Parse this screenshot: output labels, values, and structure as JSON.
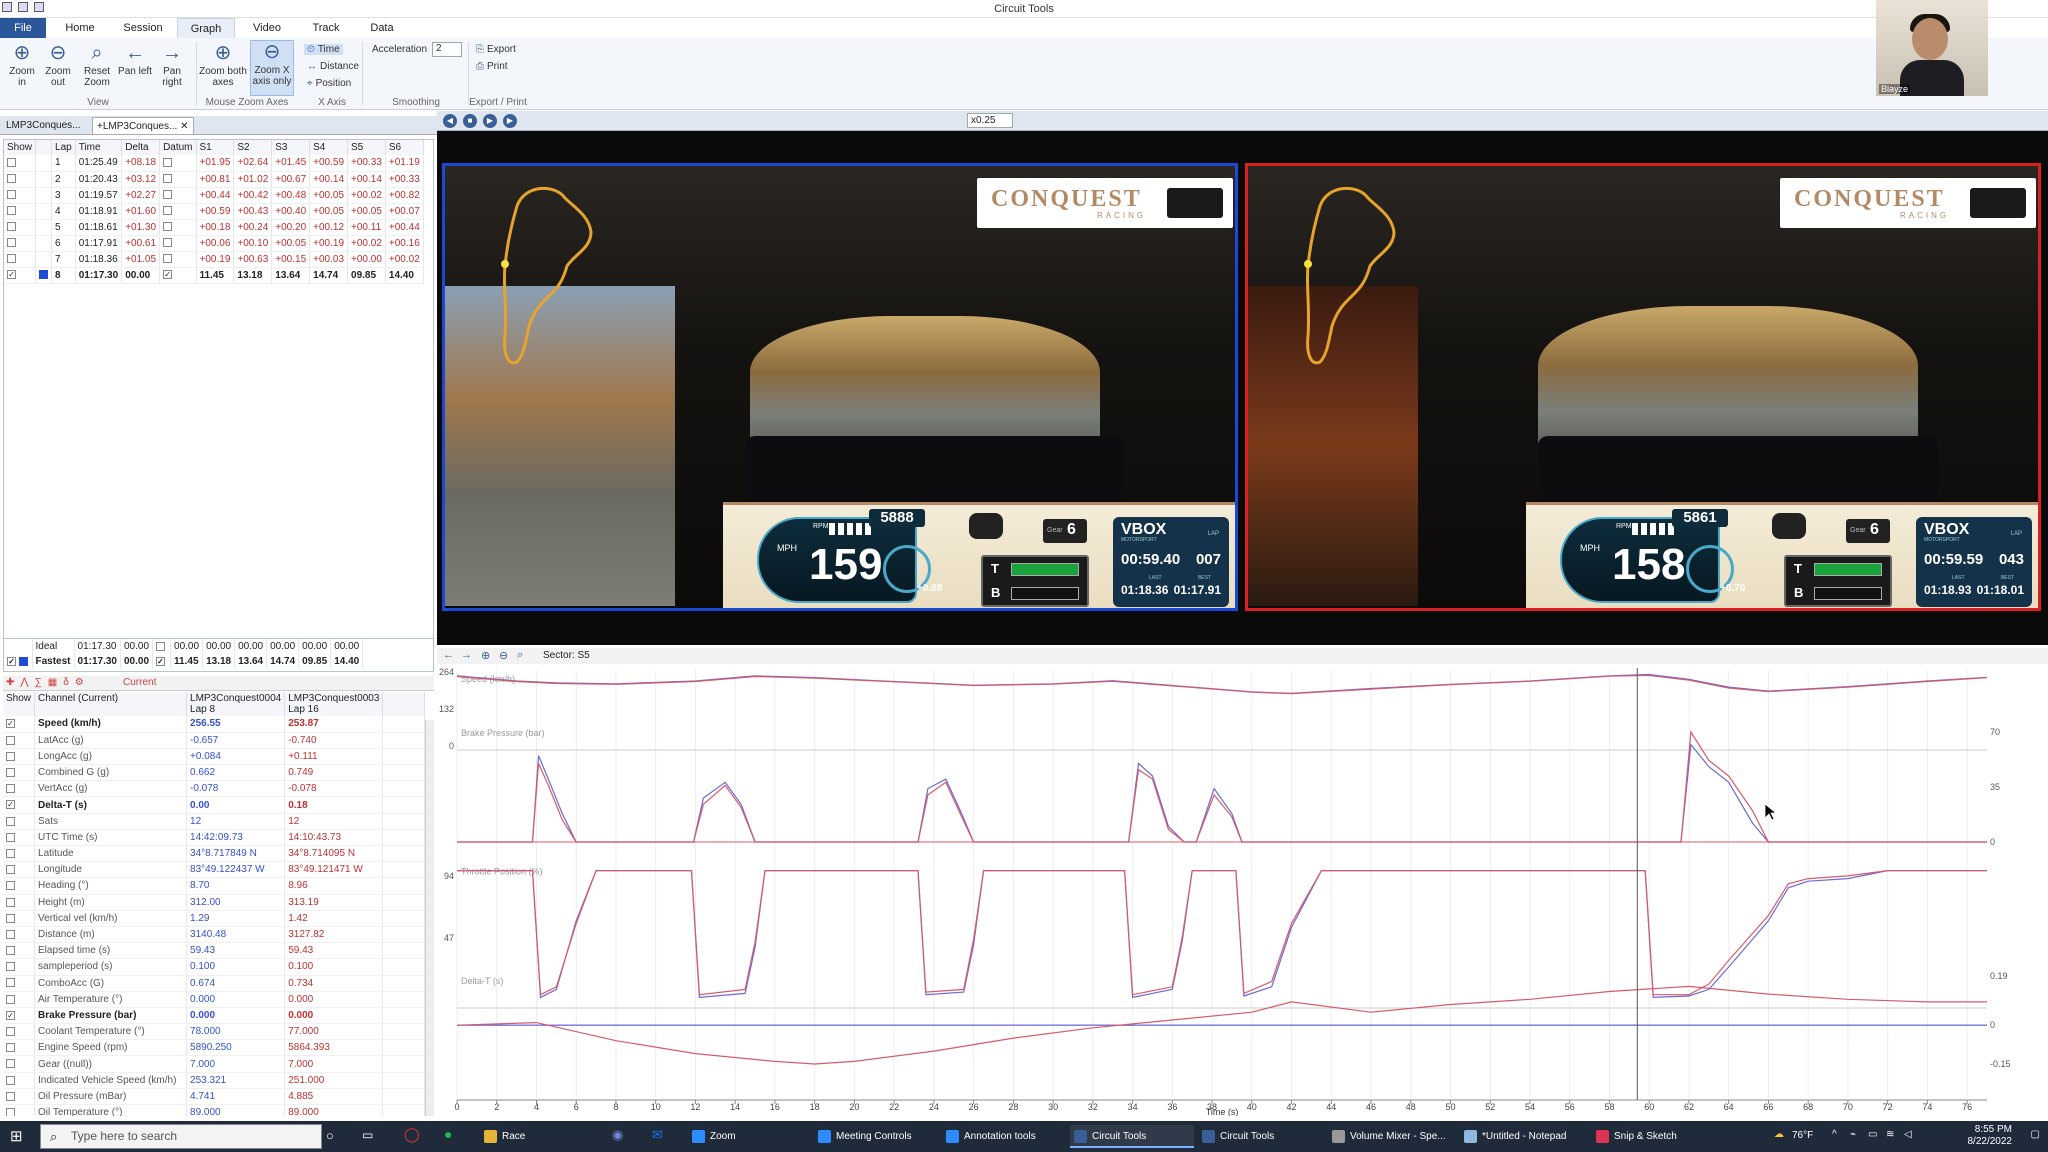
{
  "app": {
    "title": "Circuit Tools"
  },
  "menu": {
    "tabs": [
      "File",
      "Home",
      "Session",
      "Graph",
      "Video",
      "Track",
      "Data"
    ],
    "active": "Graph"
  },
  "ribbon": {
    "view_buttons": [
      "Zoom in",
      "Zoom out",
      "Reset Zoom",
      "Pan left",
      "Pan right"
    ],
    "view_group": "View",
    "zoom_buttons": [
      "Zoom both axes",
      "Zoom X axis only"
    ],
    "zoom_group": "Mouse Zoom Axes",
    "x_axis_options": [
      "Time",
      "Distance",
      "Position"
    ],
    "x_axis_group": "X Axis",
    "acceleration_label": "Acceleration",
    "acceleration_value": "2",
    "smoothing_group": "Smoothing",
    "export_label": "Export",
    "print_label": "Print",
    "export_group": "Export / Print"
  },
  "webcam": {
    "name": "Blayze"
  },
  "session_tabs": [
    "LMP3Conques...",
    "+LMP3Conques..."
  ],
  "lap_table": {
    "headers": [
      "Show",
      "Lap",
      "Time",
      "Delta",
      "Datum",
      "S1",
      "S2",
      "S3",
      "S4",
      "S5",
      "S6"
    ],
    "rows": [
      {
        "lap": "1",
        "time": "01:25.49",
        "delta": "+08.18",
        "s": [
          "+01.95",
          "+02.64",
          "+01.45",
          "+00.59",
          "+00.33",
          "+01.19"
        ]
      },
      {
        "lap": "2",
        "time": "01:20.43",
        "delta": "+03.12",
        "s": [
          "+00.81",
          "+01.02",
          "+00.67",
          "+00.14",
          "+00.14",
          "+00.33"
        ]
      },
      {
        "lap": "3",
        "time": "01:19.57",
        "delta": "+02.27",
        "s": [
          "+00.44",
          "+00.42",
          "+00.48",
          "+00.05",
          "+00.02",
          "+00.82"
        ]
      },
      {
        "lap": "4",
        "time": "01:18.91",
        "delta": "+01.60",
        "s": [
          "+00.59",
          "+00.43",
          "+00.40",
          "+00.05",
          "+00.05",
          "+00.07"
        ]
      },
      {
        "lap": "5",
        "time": "01:18.61",
        "delta": "+01.30",
        "s": [
          "+00.18",
          "+00.24",
          "+00.20",
          "+00.12",
          "+00.11",
          "+00.44"
        ]
      },
      {
        "lap": "6",
        "time": "01:17.91",
        "delta": "+00.61",
        "s": [
          "+00.06",
          "+00.10",
          "+00.05",
          "+00.19",
          "+00.02",
          "+00.16"
        ]
      },
      {
        "lap": "7",
        "time": "01:18.36",
        "delta": "+01.05",
        "s": [
          "+00.19",
          "+00.63",
          "+00.15",
          "+00.03",
          "+00.00",
          "+00.02"
        ]
      },
      {
        "lap": "8",
        "time": "01:17.30",
        "delta": "00.00",
        "s": [
          "11.45",
          "13.18",
          "13.64",
          "14.74",
          "09.85",
          "14.40"
        ]
      }
    ],
    "ideal": {
      "label": "Ideal",
      "time": "01:17.30",
      "delta": "00.00",
      "s": [
        "00.00",
        "00.00",
        "00.00",
        "00.00",
        "00.00",
        "00.00"
      ]
    },
    "fastest": {
      "label": "Fastest",
      "time": "01:17.30",
      "delta": "00.00",
      "s": [
        "11.45",
        "13.18",
        "13.64",
        "14.74",
        "09.85",
        "14.40"
      ]
    }
  },
  "channel_toolbar": {
    "current_label": "Current"
  },
  "channel_table": {
    "headers": [
      "Show",
      "Channel (Current)",
      "LMP3Conquest0004 Lap 8",
      "LMP3Conquest0003 Lap 16"
    ],
    "rows": [
      {
        "name": "Speed (km/h)",
        "checked": true,
        "a": "256.55",
        "b": "253.87"
      },
      {
        "name": "LatAcc (g)",
        "checked": false,
        "a": "-0.657",
        "b": "-0.740"
      },
      {
        "name": "LongAcc (g)",
        "checked": false,
        "a": "+0.084",
        "b": "+0.111"
      },
      {
        "name": "Combined G (g)",
        "checked": false,
        "a": "0.662",
        "b": "0.749"
      },
      {
        "name": "VertAcc (g)",
        "checked": false,
        "a": "-0.078",
        "b": "-0.078"
      },
      {
        "name": "Delta-T (s)",
        "checked": true,
        "a": "0.00",
        "b": "0.18"
      },
      {
        "name": "Sats",
        "checked": false,
        "a": "12",
        "b": "12"
      },
      {
        "name": "UTC Time (s)",
        "checked": false,
        "a": "14:42:09.73",
        "b": "14:10:43.73"
      },
      {
        "name": "Latitude",
        "checked": false,
        "a": "34°8.717849 N",
        "b": "34°8.714095 N"
      },
      {
        "name": "Longitude",
        "checked": false,
        "a": "83°49.122437 W",
        "b": "83°49.121471 W"
      },
      {
        "name": "Heading (°)",
        "checked": false,
        "a": "8.70",
        "b": "8.96"
      },
      {
        "name": "Height (m)",
        "checked": false,
        "a": "312.00",
        "b": "313.19"
      },
      {
        "name": "Vertical vel (km/h)",
        "checked": false,
        "a": "1.29",
        "b": "1.42"
      },
      {
        "name": "Distance (m)",
        "checked": false,
        "a": "3140.48",
        "b": "3127.82"
      },
      {
        "name": "Elapsed time (s)",
        "checked": false,
        "a": "59.43",
        "b": "59.43"
      },
      {
        "name": "sampleperiod (s)",
        "checked": false,
        "a": "0.100",
        "b": "0.100"
      },
      {
        "name": "ComboAcc (G)",
        "checked": false,
        "a": "0.674",
        "b": "0.734"
      },
      {
        "name": "Air Temperature (°)",
        "checked": false,
        "a": "0.000",
        "b": "0.000"
      },
      {
        "name": "Brake Pressure (bar)",
        "checked": true,
        "a": "0.000",
        "b": "0.000"
      },
      {
        "name": "Coolant Temperature (°)",
        "checked": false,
        "a": "78.000",
        "b": "77.000"
      },
      {
        "name": "Engine Speed (rpm)",
        "checked": false,
        "a": "5890.250",
        "b": "5864.393"
      },
      {
        "name": "Gear ((null))",
        "checked": false,
        "a": "7.000",
        "b": "7.000"
      },
      {
        "name": "Indicated Vehicle Speed (km/h)",
        "checked": false,
        "a": "253.321",
        "b": "251.000"
      },
      {
        "name": "Oil Pressure (mBar)",
        "checked": false,
        "a": "4.741",
        "b": "4.885"
      },
      {
        "name": "Oil Temperature (°)",
        "checked": false,
        "a": "89.000",
        "b": "89.000"
      }
    ]
  },
  "video": {
    "speed": "x0.25",
    "left": {
      "brand": "CONQUEST",
      "brand_sub": "RACING",
      "rpm": "5888",
      "speed": "159",
      "speed_unit": "MPH",
      "rpm_label": "RPM",
      "delta": "+0.68",
      "gear_label": "Gear",
      "gear": "6",
      "throttle_label": "T",
      "brake_label": "B",
      "vbox_label": "VBOX",
      "vbox_sub": "MOTORSPORT",
      "lap_label": "LAP",
      "lap_time": "00:59.40",
      "lap_number": "007",
      "last_label": "LAST",
      "best_label": "BEST",
      "last_time": "01:18.36",
      "best_time": "01:17.91",
      "throttle": 1.0
    },
    "right": {
      "brand": "CONQUEST",
      "brand_sub": "RACING",
      "rpm": "5861",
      "speed": "158",
      "speed_unit": "MPH",
      "rpm_label": "RPM",
      "delta": "+0.70",
      "gear_label": "Gear",
      "gear": "6",
      "throttle_label": "T",
      "brake_label": "B",
      "vbox_label": "VBOX",
      "vbox_sub": "MOTORSPORT",
      "lap_label": "LAP",
      "lap_time": "00:59.59",
      "lap_number": "043",
      "last_label": "LAST",
      "best_label": "BEST",
      "last_time": "01:18.93",
      "best_time": "01:18.01",
      "throttle": 1.0
    }
  },
  "graph_toolbar": {
    "sector": "Sector: S5"
  },
  "chart_data": {
    "type": "line",
    "xlabel": "Time (s)",
    "xlim": [
      0,
      77
    ],
    "x_ticks": [
      "0",
      "2",
      "4",
      "6",
      "8",
      "10",
      "12",
      "14",
      "16",
      "18",
      "20",
      "22",
      "24",
      "26",
      "28",
      "30",
      "32",
      "34",
      "36",
      "38",
      "40",
      "42",
      "44",
      "46",
      "48",
      "50",
      "52",
      "54",
      "56",
      "58",
      "60",
      "62",
      "64",
      "66",
      "68",
      "70",
      "72",
      "74",
      "76"
    ],
    "cursor_x": 59.4,
    "colors": {
      "lap_a": "#6a6ad8",
      "lap_b": "#d85a6a"
    },
    "panels": [
      {
        "label": "Speed (km/h)",
        "y_ticks": [
          "264",
          "132",
          "0"
        ],
        "ylim": [
          0,
          264
        ],
        "x": [
          0,
          3,
          5,
          8,
          12,
          15,
          18,
          22,
          26,
          30,
          33,
          37,
          40,
          42,
          46,
          50,
          54,
          58,
          60,
          62,
          64,
          66,
          70,
          74,
          77
        ],
        "series": [
          {
            "values": [
              250,
              232,
              225,
              222,
              232,
              250,
              244,
              230,
              217,
              222,
              233,
              210,
              193,
              188,
              205,
              220,
              232,
              250,
              255,
              238,
              210,
              196,
              212,
              232,
              245
            ]
          },
          {
            "values": [
              248,
              230,
              223,
              220,
              230,
              248,
              242,
              229,
              216,
              221,
              231,
              209,
              192,
              187,
              203,
              219,
              231,
              249,
              252,
              235,
              207,
              194,
              210,
              230,
              244
            ]
          }
        ]
      },
      {
        "label": "Brake Pressure (bar)",
        "y_ticks": [
          "70",
          "35",
          "0"
        ],
        "ylim": [
          0,
          70
        ],
        "x": [
          0,
          3.8,
          4.1,
          4.6,
          5.3,
          6,
          11.9,
          12.4,
          13.5,
          14.3,
          15,
          23.2,
          23.7,
          24.6,
          25.4,
          26,
          33.8,
          34.3,
          35,
          35.8,
          36.6,
          37.2,
          38.1,
          39,
          39.5,
          41,
          60,
          61.6,
          62.1,
          63,
          64,
          65.2,
          66,
          77
        ],
        "series": [
          {
            "values": [
              0,
              0,
              55,
              40,
              18,
              0,
              0,
              28,
              38,
              24,
              0,
              0,
              34,
              40,
              18,
              0,
              0,
              50,
              42,
              10,
              0,
              0,
              34,
              18,
              0,
              0,
              0,
              0,
              62,
              48,
              38,
              12,
              0,
              0
            ]
          },
          {
            "values": [
              0,
              0,
              50,
              36,
              14,
              0,
              0,
              24,
              36,
              22,
              0,
              0,
              30,
              38,
              16,
              0,
              0,
              46,
              40,
              8,
              0,
              0,
              30,
              16,
              0,
              0,
              0,
              0,
              70,
              52,
              42,
              20,
              0,
              0
            ]
          }
        ]
      },
      {
        "label": "Throttle Position (%)",
        "y_ticks": [
          "94",
          "47"
        ],
        "ylim": [
          0,
          100
        ],
        "x": [
          0,
          3.8,
          4.2,
          5,
          6,
          7,
          11.8,
          12.2,
          14.5,
          15,
          15.5,
          23.2,
          23.6,
          25.5,
          26,
          26.5,
          33.6,
          34,
          36,
          36.5,
          37,
          39.2,
          39.6,
          41,
          42,
          43.5,
          59.8,
          60.2,
          62,
          63,
          64,
          66,
          67,
          68,
          70,
          72,
          77
        ],
        "series": [
          {
            "values": [
              98,
              98,
              2,
              8,
              60,
              98,
              98,
              2,
              5,
              40,
              98,
              98,
              4,
              6,
              42,
              98,
              98,
              2,
              8,
              45,
              98,
              98,
              3,
              10,
              55,
              98,
              98,
              2,
              3,
              8,
              25,
              60,
              85,
              90,
              92,
              98,
              98
            ]
          },
          {
            "values": [
              98,
              98,
              4,
              10,
              58,
              98,
              98,
              4,
              8,
              44,
              98,
              98,
              6,
              8,
              46,
              98,
              98,
              4,
              10,
              48,
              98,
              98,
              5,
              14,
              58,
              98,
              98,
              4,
              4,
              12,
              30,
              64,
              88,
              92,
              94,
              98,
              98
            ]
          }
        ]
      },
      {
        "label": "Delta-T (s)",
        "y_ticks": [
          "0.19",
          "0",
          "-0.15"
        ],
        "ylim": [
          -0.15,
          0.19
        ],
        "x": [
          0,
          4,
          8,
          12,
          16,
          18,
          20,
          24,
          28,
          32,
          36,
          40,
          42,
          46,
          50,
          54,
          58,
          62,
          66,
          70,
          74,
          77
        ],
        "series": [
          {
            "values": [
              0,
              0,
              0,
              0,
              0,
              0,
              0,
              0,
              0,
              0,
              0,
              0,
              0,
              0,
              0,
              0,
              0,
              0,
              0,
              0,
              0,
              0
            ]
          },
          {
            "values": [
              0,
              0.01,
              -0.06,
              -0.11,
              -0.14,
              -0.15,
              -0.14,
              -0.1,
              -0.05,
              -0.01,
              0.02,
              0.05,
              0.09,
              0.05,
              0.08,
              0.1,
              0.13,
              0.15,
              0.12,
              0.1,
              0.09,
              0.09
            ]
          }
        ]
      }
    ]
  },
  "taskbar": {
    "search_placeholder": "Type here to search",
    "items": [
      "Race",
      "Zoom",
      "Meeting Controls",
      "Annotation tools",
      "Circuit Tools",
      "Circuit Tools",
      "Volume Mixer - Spe...",
      "*Untitled - Notepad",
      "Snip & Sketch"
    ],
    "temperature": "76°F",
    "time": "8:55 PM",
    "date": "8/22/2022"
  }
}
